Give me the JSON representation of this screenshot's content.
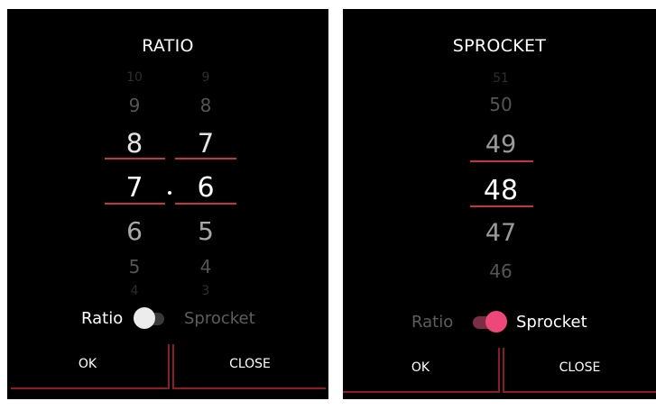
{
  "ratio_dialog": {
    "title": "RATIO",
    "left_picker": {
      "values_above": [
        "10",
        "9",
        "8"
      ],
      "selected": "7",
      "values_below": [
        "6",
        "5",
        "4"
      ]
    },
    "separator": "·",
    "right_picker": {
      "values_above": [
        "9",
        "8",
        "7"
      ],
      "selected": "6",
      "values_below": [
        "5",
        "4",
        "3"
      ]
    },
    "mode_switch": {
      "left_label": "Ratio",
      "right_label": "Sprocket",
      "state": "Ratio"
    },
    "buttons": {
      "ok_label": "OK",
      "close_label": "CLOSE"
    }
  },
  "sprocket_dialog": {
    "title": "SPROCKET",
    "picker": {
      "values_above": [
        "51",
        "50",
        "49"
      ],
      "selected": "48",
      "values_below": [
        "47",
        "46"
      ]
    },
    "mode_switch": {
      "left_label": "Ratio",
      "right_label": "Sprocket",
      "state": "Sprocket"
    },
    "buttons": {
      "ok_label": "OK",
      "close_label": "CLOSE"
    }
  },
  "colors": {
    "dialog_background": "#000000",
    "selection_line": "#c4373e",
    "button_border": "#8c1d24",
    "switch_on_thumb": "#f0477a",
    "switch_on_track": "#7a2d44",
    "switch_off_thumb": "#ececec"
  }
}
